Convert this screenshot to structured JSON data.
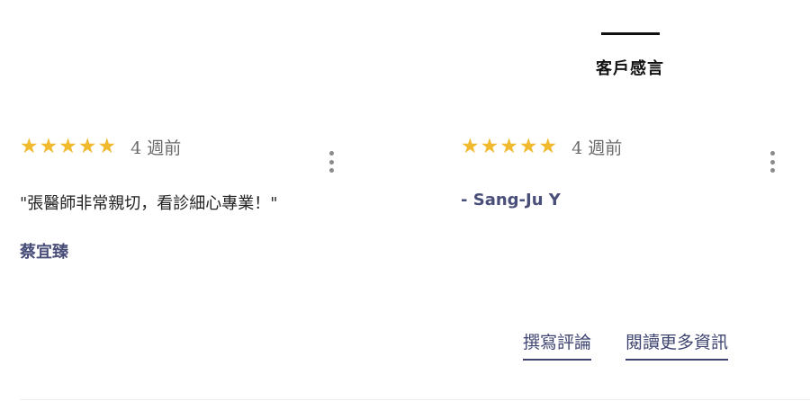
{
  "section": {
    "title": "客戶感言"
  },
  "reviews": [
    {
      "stars": [
        "★",
        "★",
        "★",
        "★",
        "★"
      ],
      "date": "4 週前",
      "quote": "\"張醫師非常親切，看診細心專業！\"",
      "author": "蔡宜臻"
    },
    {
      "stars": [
        "★",
        "★",
        "★",
        "★",
        "★"
      ],
      "date": "4 週前",
      "quote": "",
      "author": "- Sang-Ju Y"
    }
  ],
  "actions": {
    "write_review": "撰寫評論",
    "read_more": "閱讀更多資訊"
  },
  "colors": {
    "star": "#f0b92e",
    "accent": "#3e4470",
    "author": "#4a4f7a"
  }
}
